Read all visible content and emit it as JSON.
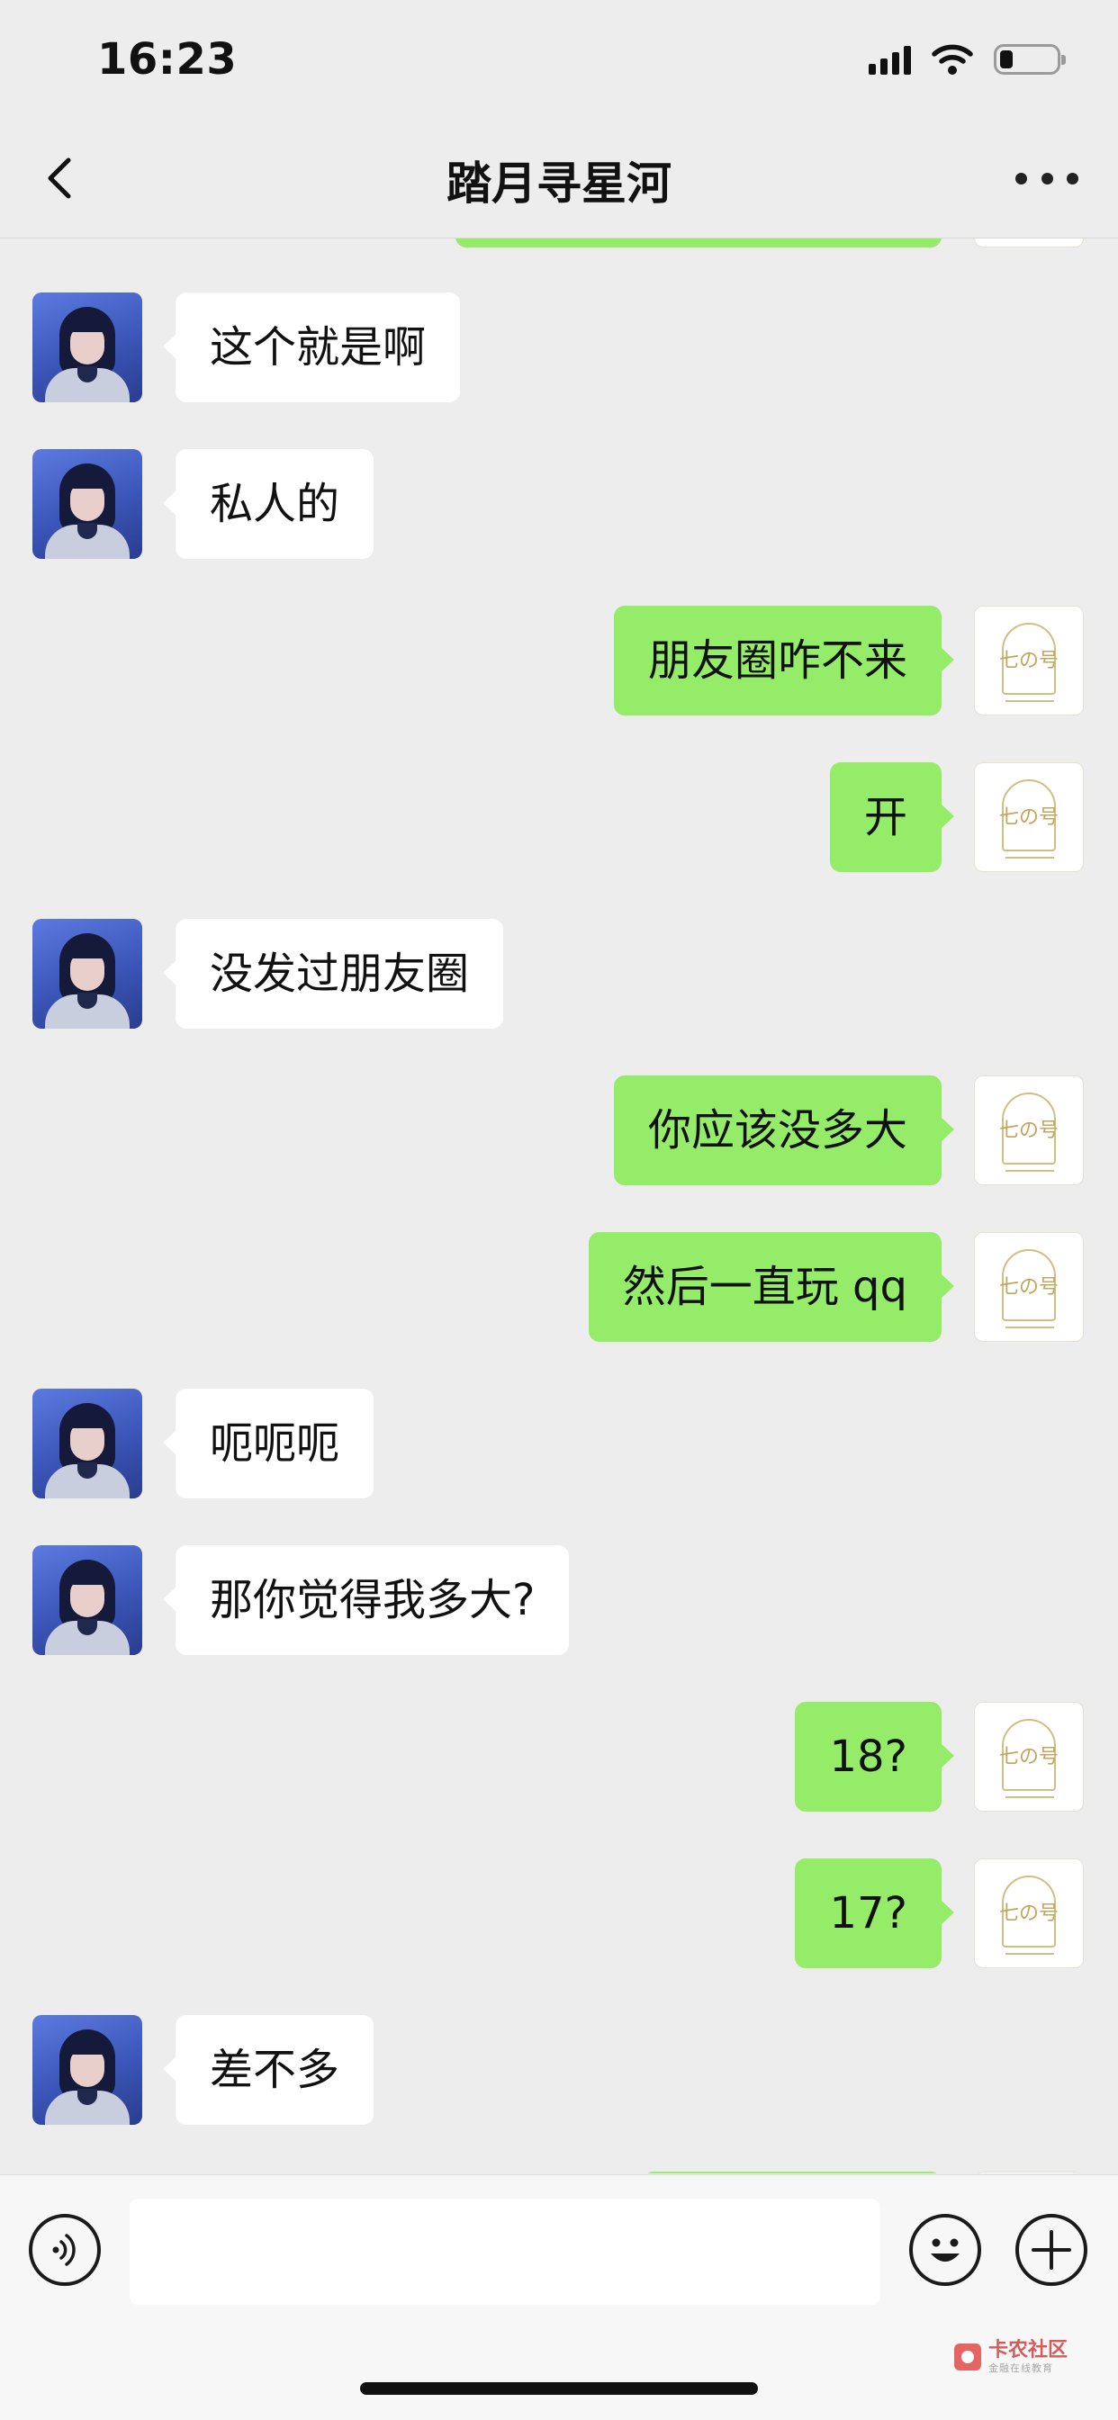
{
  "status_bar": {
    "time": "16:23"
  },
  "header": {
    "title": "踏月寻星河"
  },
  "messages": [
    {
      "from": "them",
      "text": "这个就是啊"
    },
    {
      "from": "them",
      "text": "私人的"
    },
    {
      "from": "me",
      "text": "朋友圈咋不来"
    },
    {
      "from": "me",
      "text": "开"
    },
    {
      "from": "them",
      "text": "没发过朋友圈"
    },
    {
      "from": "me",
      "text": "你应该没多大"
    },
    {
      "from": "me",
      "text": "然后一直玩 qq"
    },
    {
      "from": "them",
      "text": "呃呃呃"
    },
    {
      "from": "them",
      "text": "那你觉得我多大?"
    },
    {
      "from": "me",
      "text": "18?"
    },
    {
      "from": "me",
      "text": "17?"
    },
    {
      "from": "them",
      "text": "差不多"
    }
  ],
  "avatars": {
    "them_icon": "girl-portrait-avatar",
    "me_icon": "qi-no-yuan-logo-avatar",
    "me_logo_text": "七の号"
  },
  "input_bar": {
    "placeholder": ""
  },
  "watermark": {
    "title": "卡农社区",
    "subtitle": "金融在线教育"
  },
  "colors": {
    "background": "#ededed",
    "outgoing_bubble": "#95ec69",
    "incoming_bubble": "#ffffff"
  }
}
